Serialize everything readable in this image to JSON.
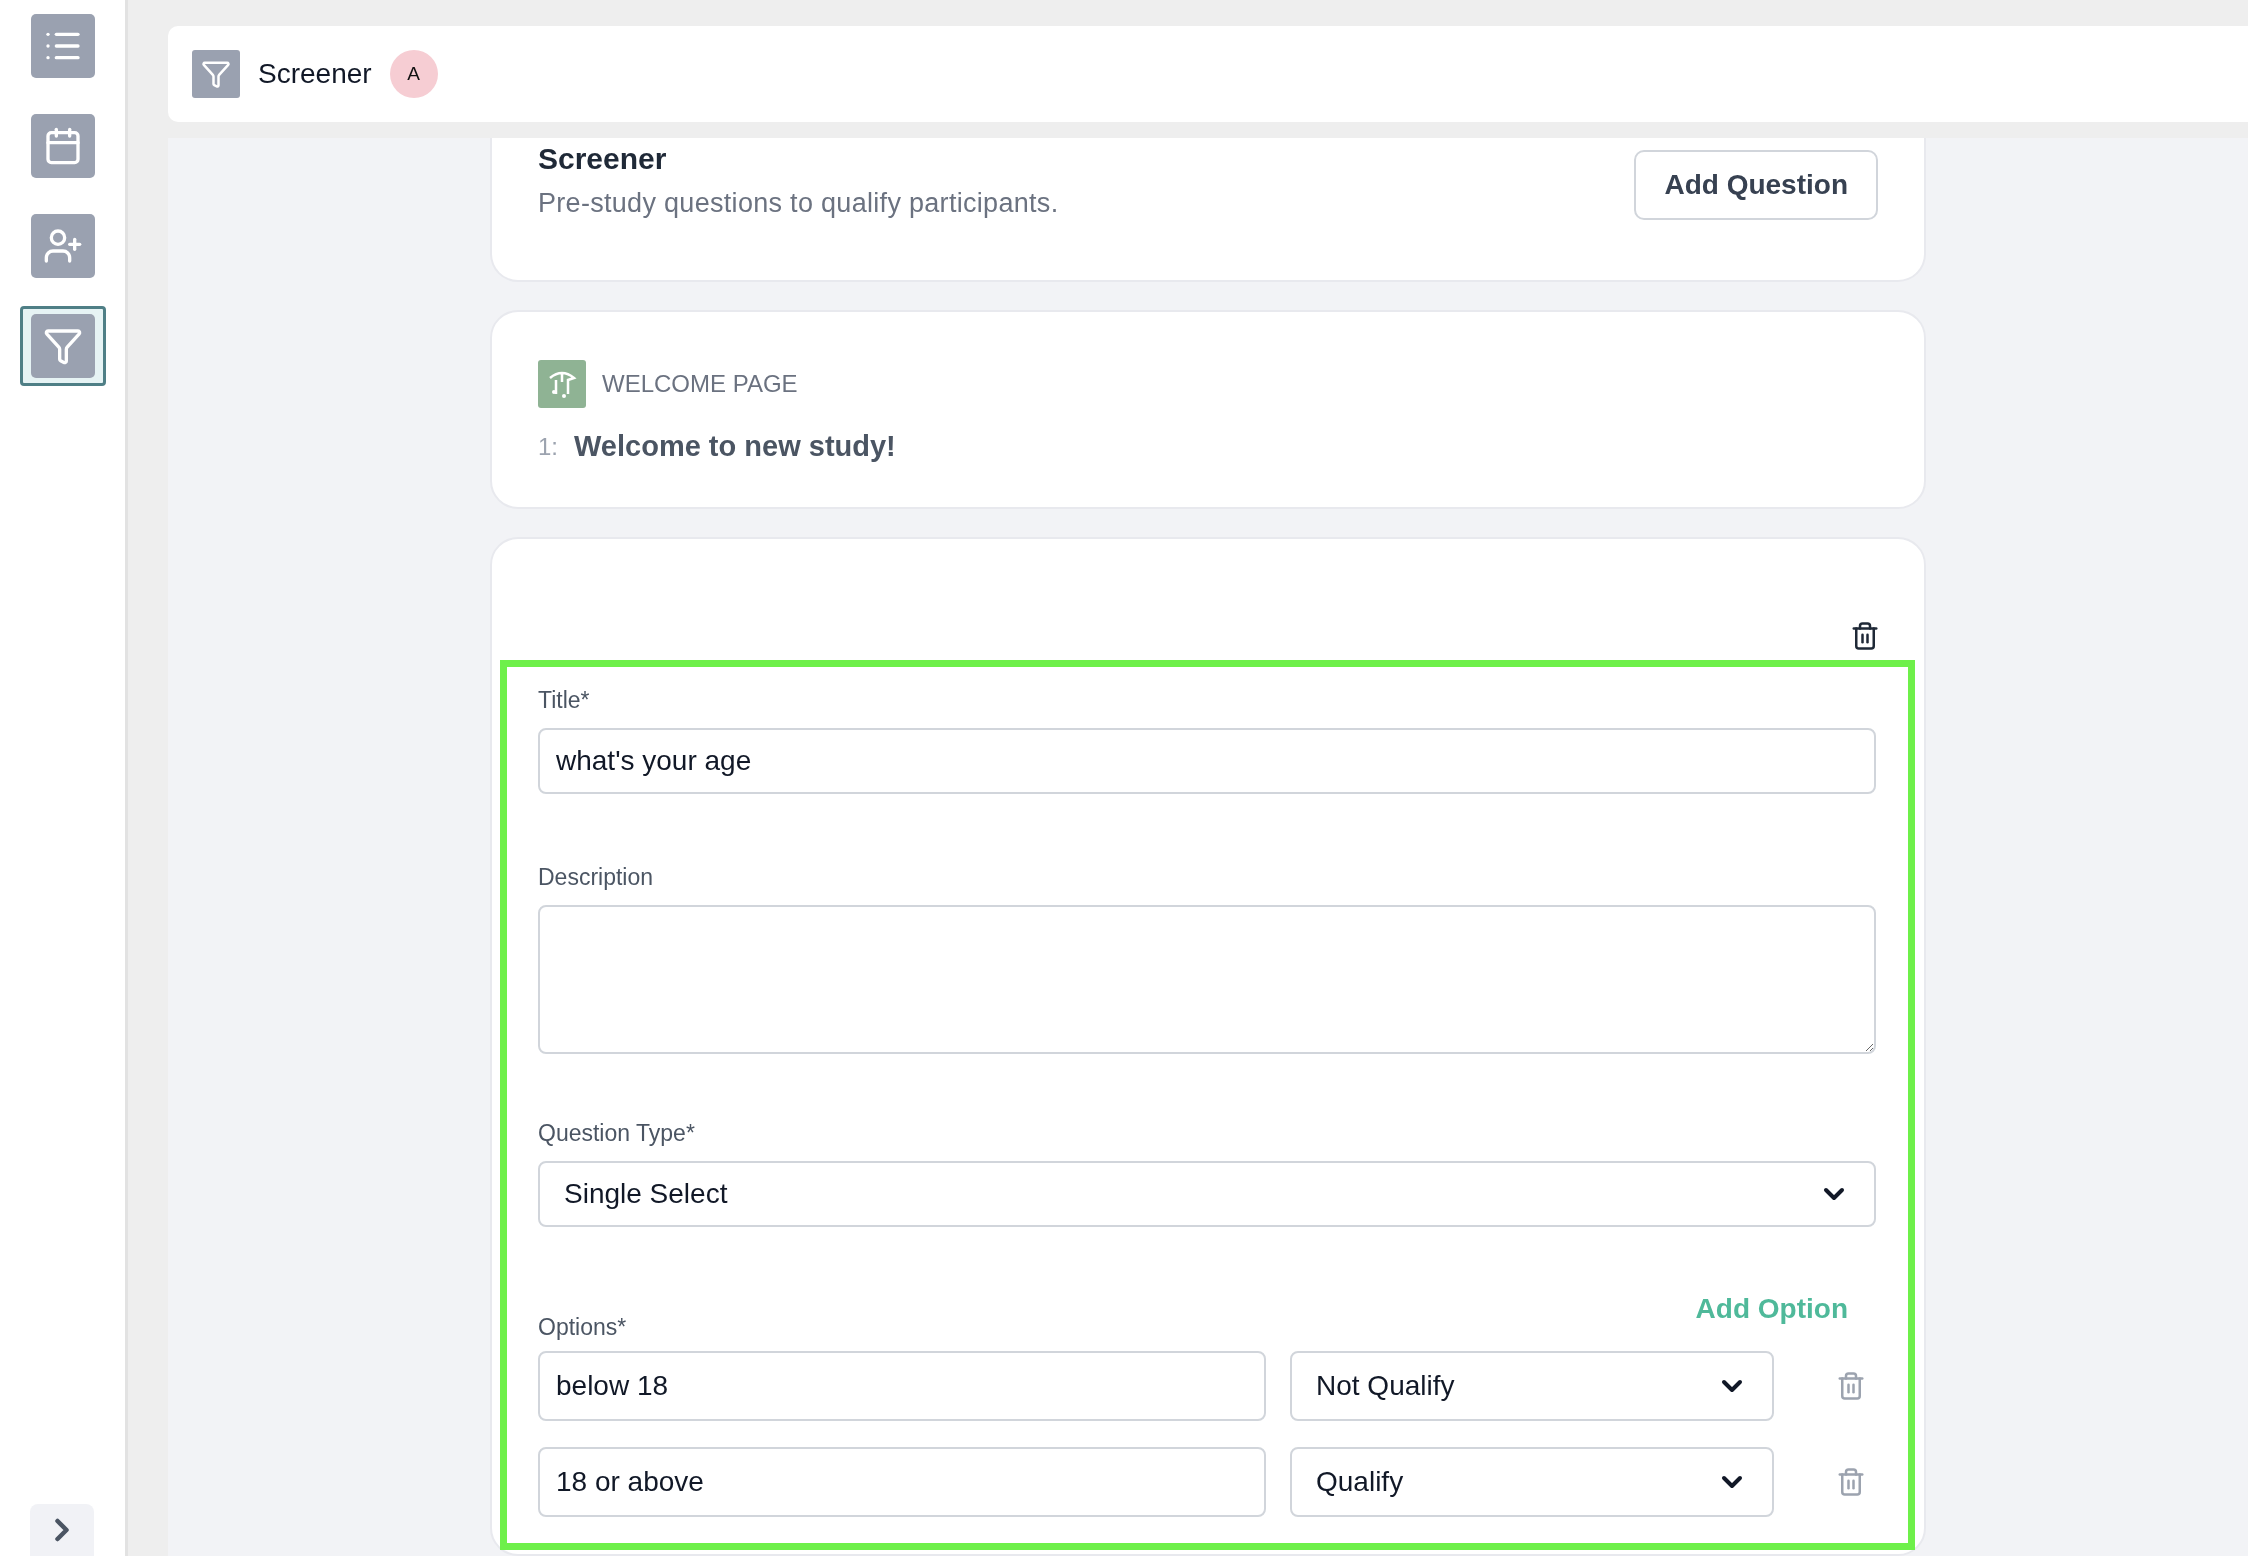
{
  "sidebar": {
    "items": [
      {
        "kind": "list",
        "selected": false
      },
      {
        "kind": "calendar",
        "selected": false
      },
      {
        "kind": "user-add",
        "selected": false
      },
      {
        "kind": "filter",
        "selected": true
      }
    ]
  },
  "header": {
    "title": "Screener",
    "avatar": "A"
  },
  "intro": {
    "title": "Screener",
    "subtitle": "Pre-study questions to qualify participants.",
    "button": "Add Question"
  },
  "welcome": {
    "label": "WELCOME PAGE",
    "number": "1:",
    "text": "Welcome to new study!"
  },
  "question": {
    "title_label": "Title*",
    "title_value": "what's your age",
    "description_label": "Description",
    "type_label": "Question Type*",
    "type_value": "Single Select",
    "options_label": "Options*",
    "add_option": "Add Option",
    "options": [
      {
        "value": "below 18",
        "result": "Not Qualify"
      },
      {
        "value": "18 or above",
        "result": "Qualify"
      }
    ]
  }
}
